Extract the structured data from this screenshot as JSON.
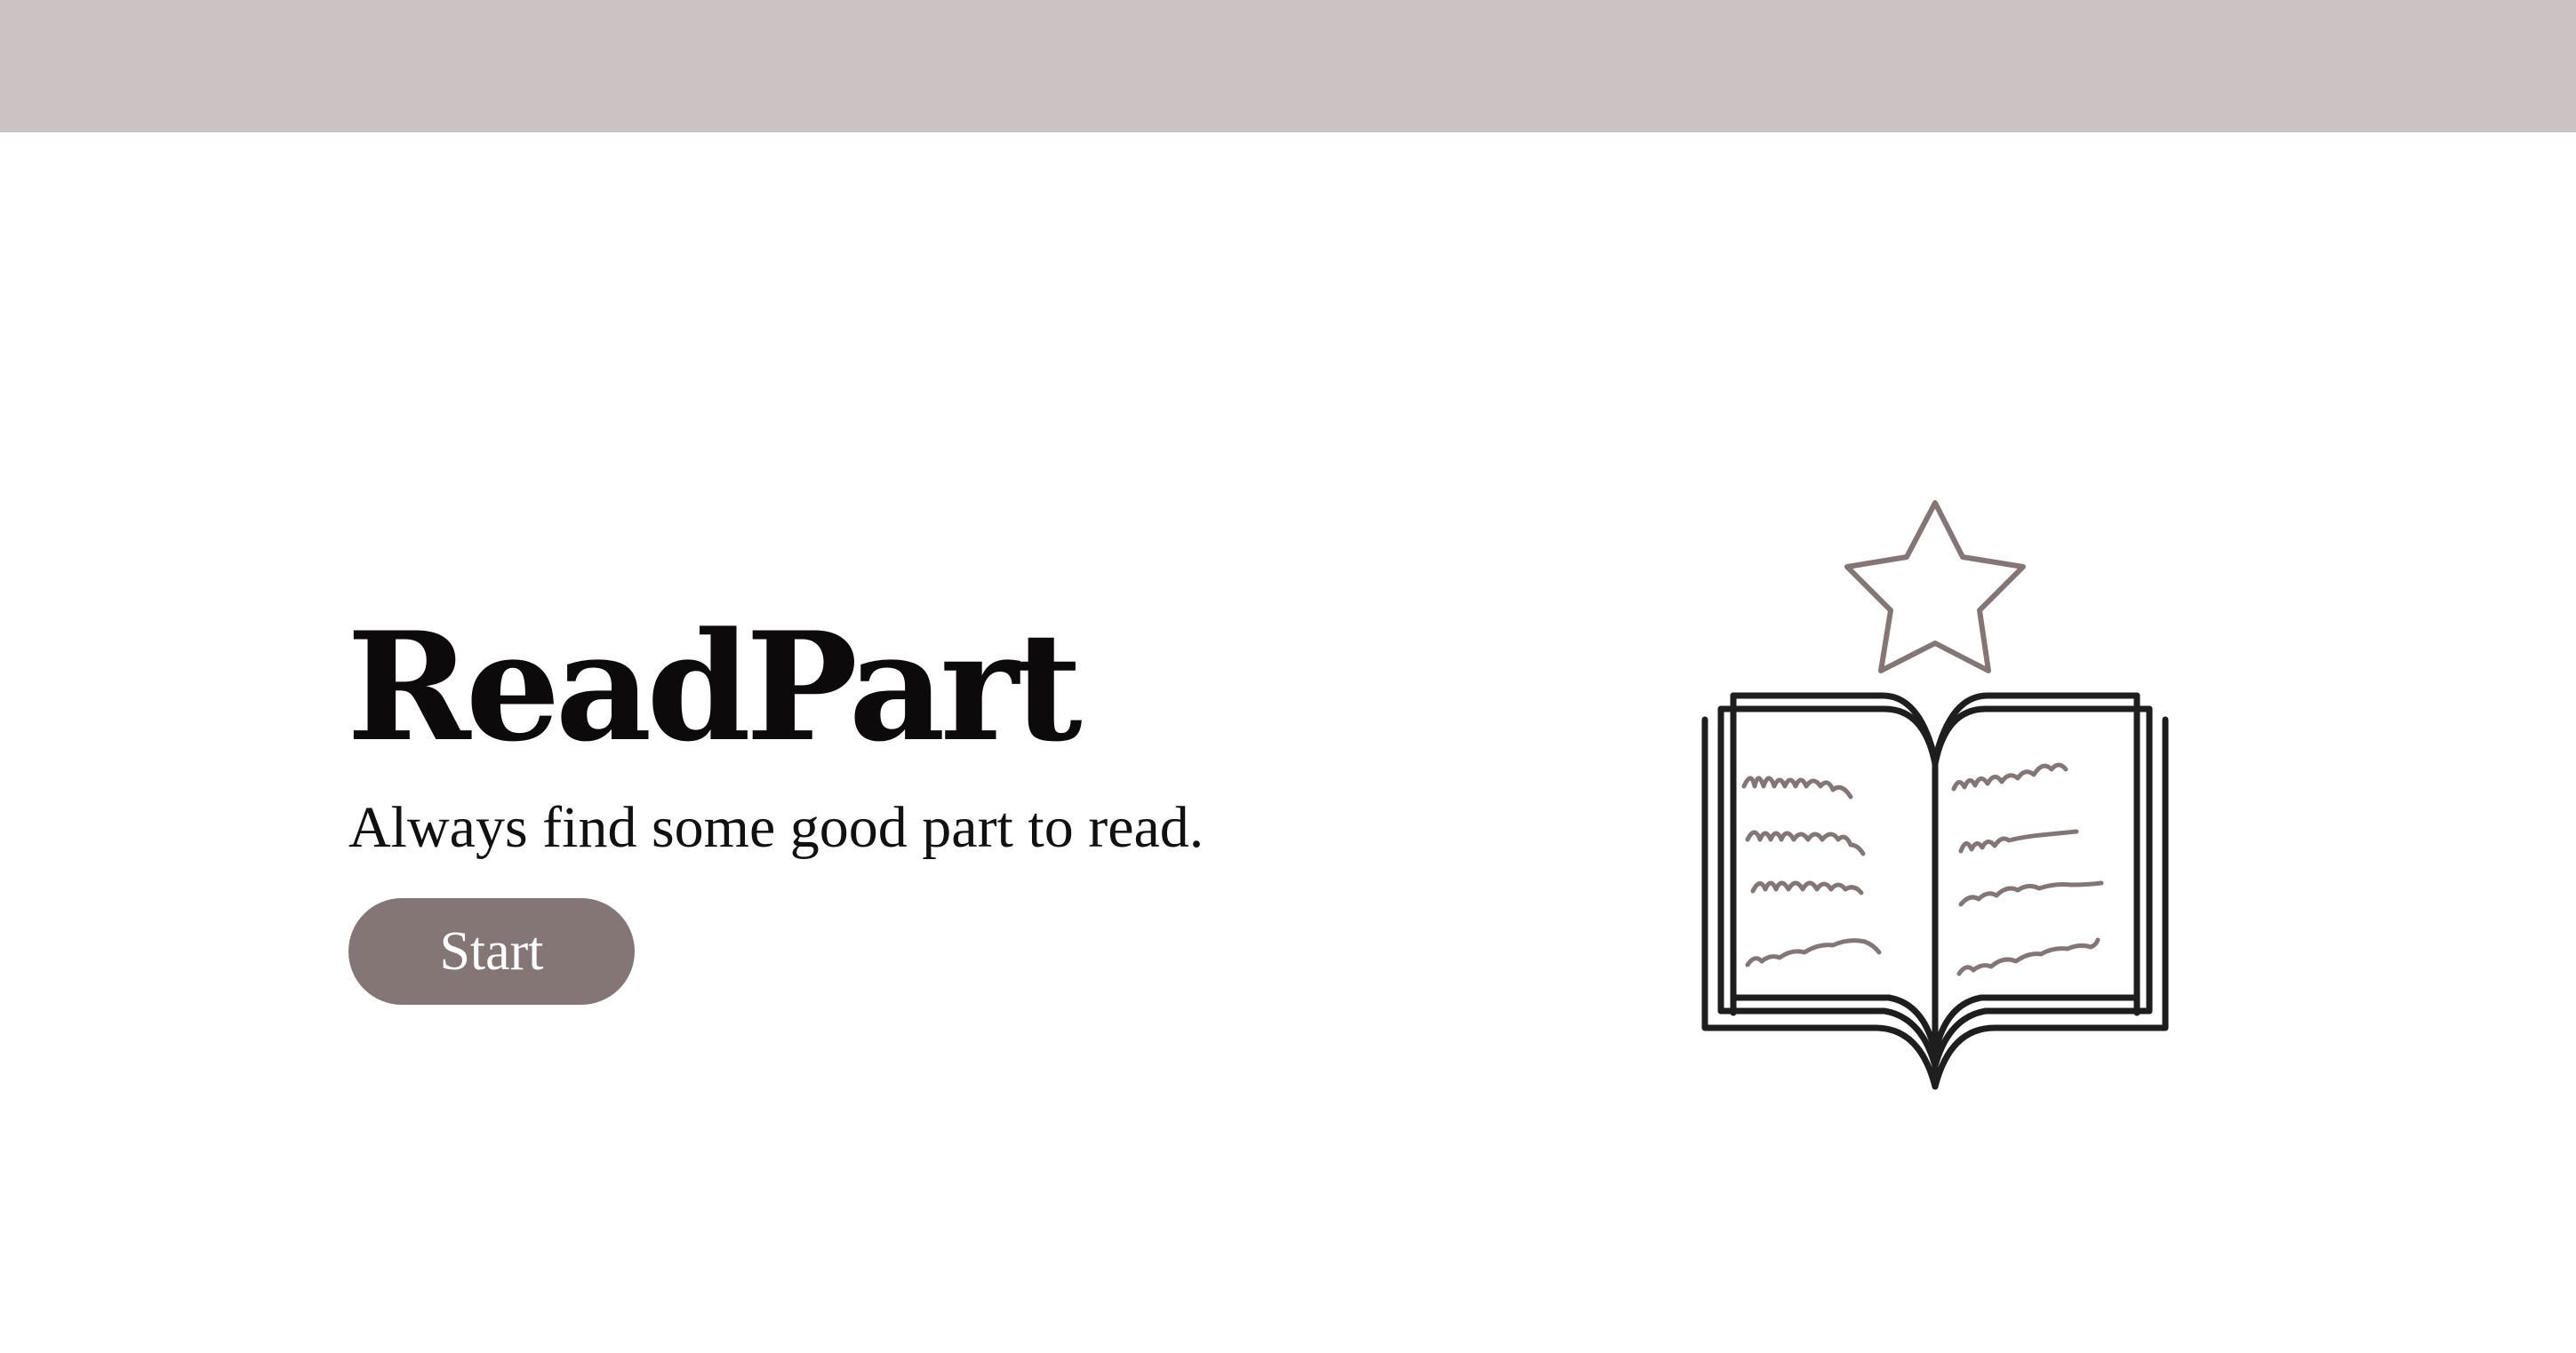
{
  "app": {
    "title": "ReadPart",
    "tagline": "Always find some good part to read."
  },
  "actions": {
    "start_label": "Start"
  },
  "illustration": {
    "icon": "open-book-with-star-icon"
  },
  "colors": {
    "top_bar": "#cbc3c3",
    "accent": "#857676",
    "ink": "#0c0a0a",
    "background": "#ffffff"
  }
}
